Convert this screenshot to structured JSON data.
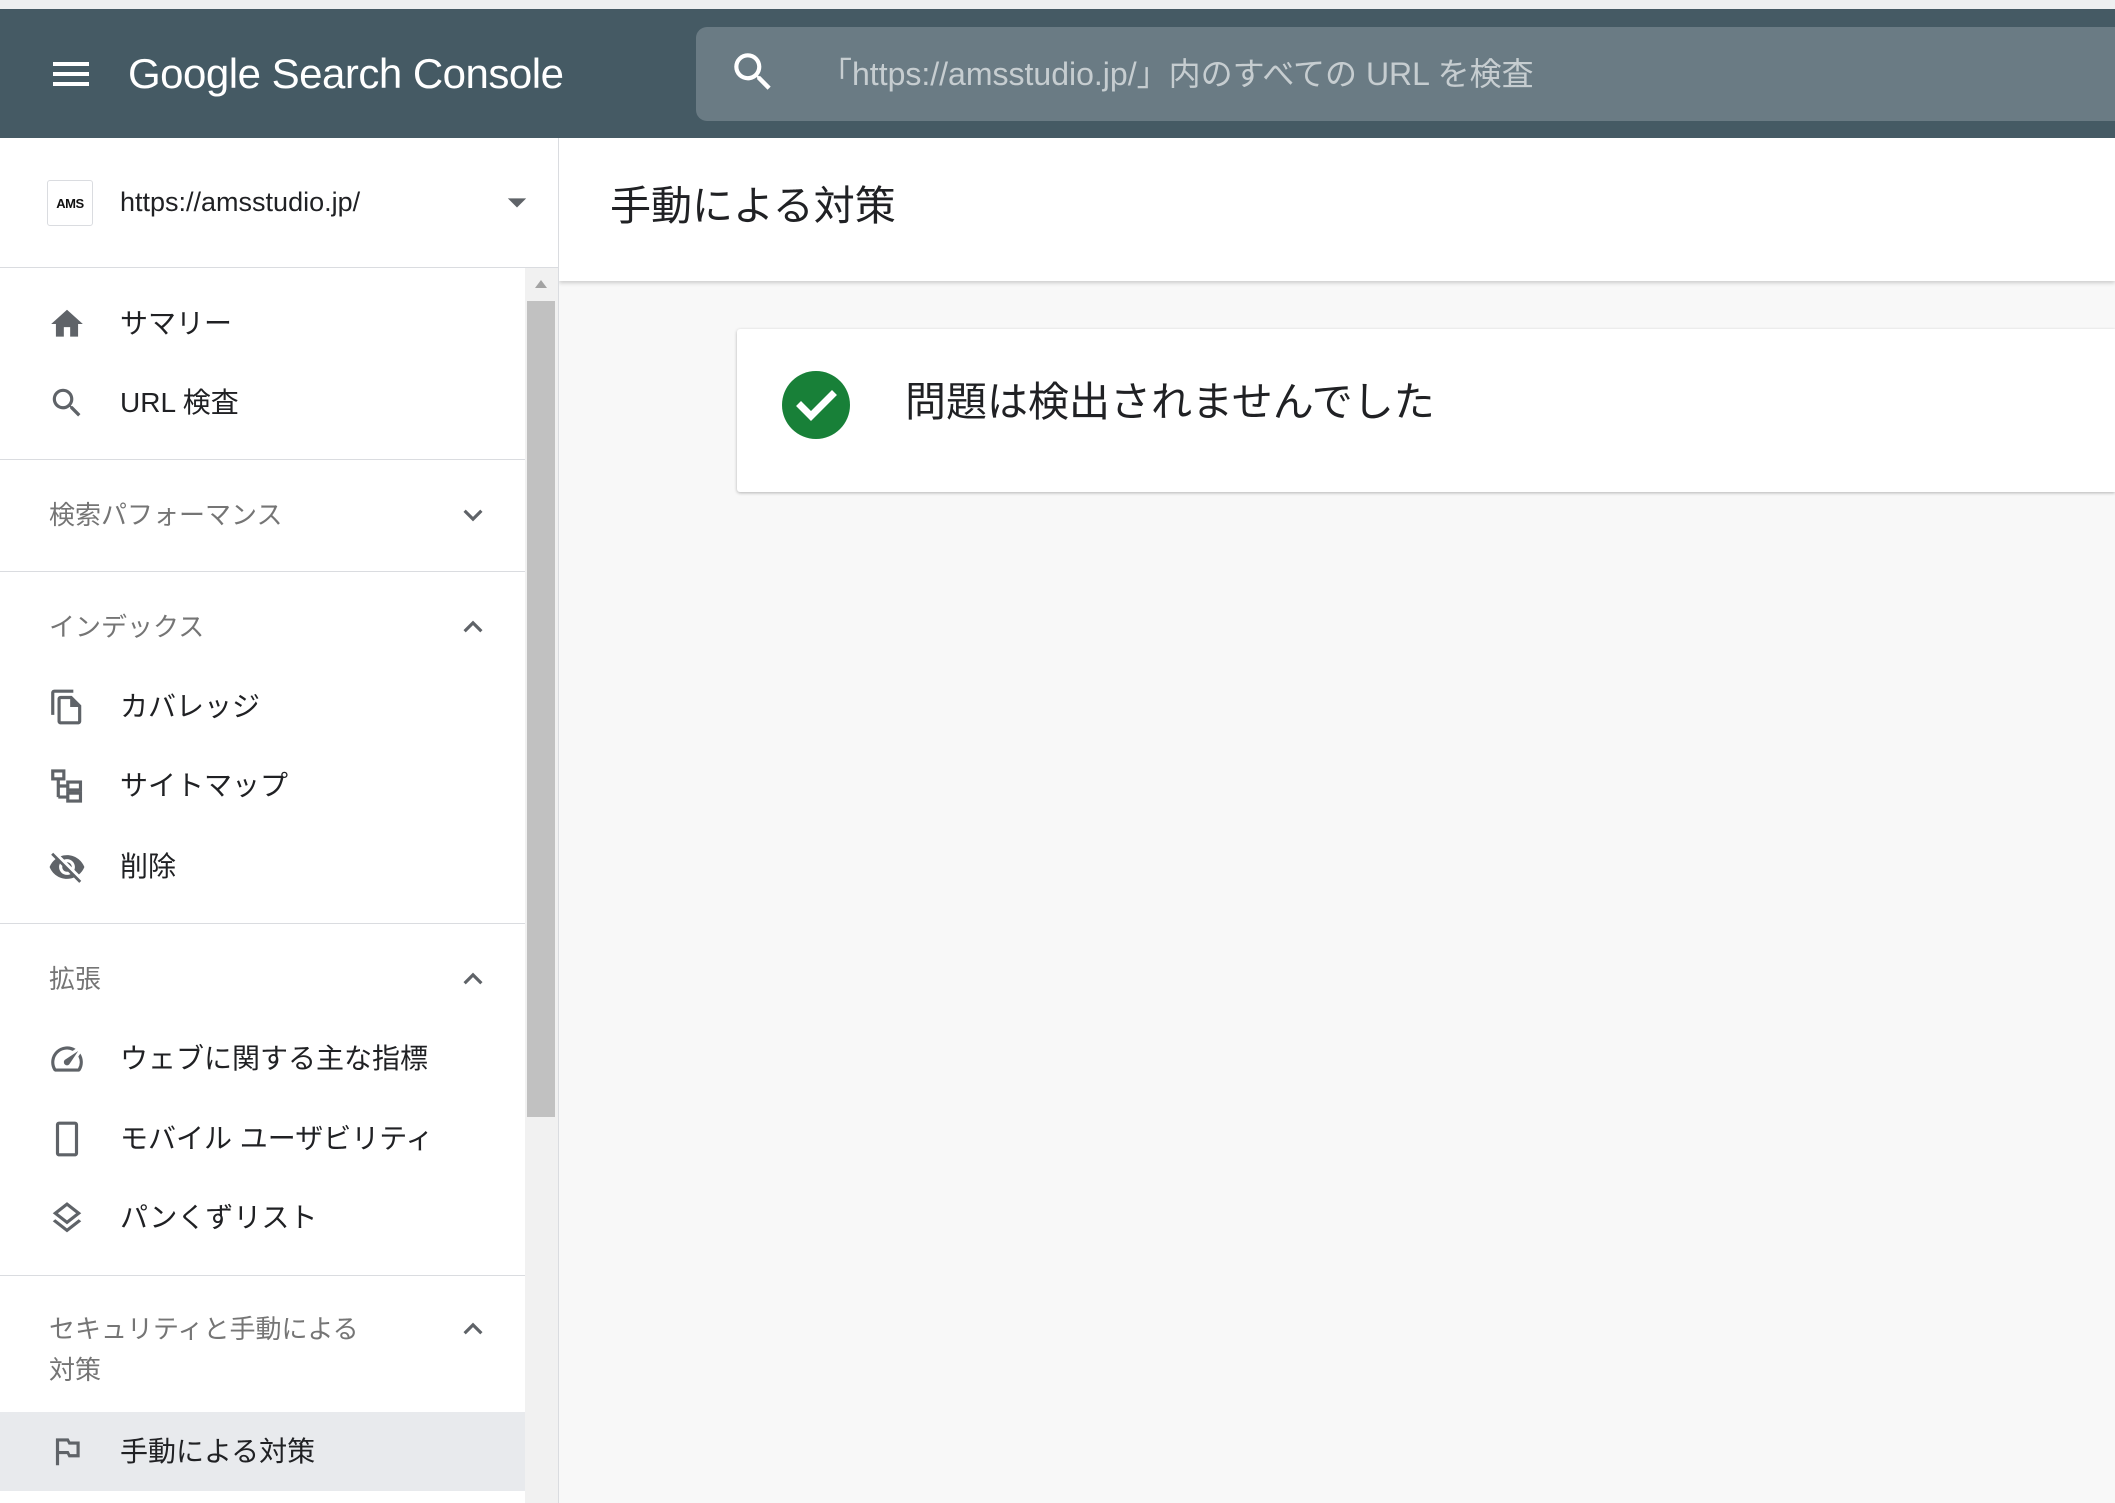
{
  "app": {
    "title": "Google Search Console",
    "menu_icon": "menu-icon",
    "search": {
      "placeholder": "「https://amsstudio.jp/」内のすべての URL を検査",
      "value": "",
      "icon": "search-icon"
    }
  },
  "property": {
    "url": "https://amsstudio.jp/",
    "logo_text": "AMS",
    "dropdown_icon": "arrow-drop-down-icon"
  },
  "sidebar": {
    "top_items": [
      {
        "label": "サマリー",
        "icon": "home-icon"
      },
      {
        "label": "URL 検査",
        "icon": "search-icon"
      }
    ],
    "sections": [
      {
        "title": "検索パフォーマンス",
        "expanded": false,
        "items": []
      },
      {
        "title": "インデックス",
        "expanded": true,
        "items": [
          {
            "label": "カバレッジ",
            "icon": "coverage-icon"
          },
          {
            "label": "サイトマップ",
            "icon": "sitemap-icon"
          },
          {
            "label": "削除",
            "icon": "visibility-off-icon"
          }
        ]
      },
      {
        "title": "拡張",
        "expanded": true,
        "items": [
          {
            "label": "ウェブに関する主な指標",
            "icon": "speed-icon"
          },
          {
            "label": "モバイル ユーザビリティ",
            "icon": "smartphone-icon"
          },
          {
            "label": "パンくずリスト",
            "icon": "layers-icon"
          }
        ]
      },
      {
        "title_lines": [
          "セキュリティと手動による",
          "対策"
        ],
        "expanded": true,
        "items": [
          {
            "label": "手動による対策",
            "icon": "flag-icon",
            "selected": true
          }
        ]
      }
    ]
  },
  "main": {
    "page_title": "手動による対策",
    "status": {
      "message": "問題は検出されませんでした",
      "icon": "check-circle-icon"
    }
  },
  "colors": {
    "header_bg": "#455a64",
    "search_bg": "#6a7b84",
    "success": "#188038",
    "selected_bg": "#e8eaed"
  }
}
